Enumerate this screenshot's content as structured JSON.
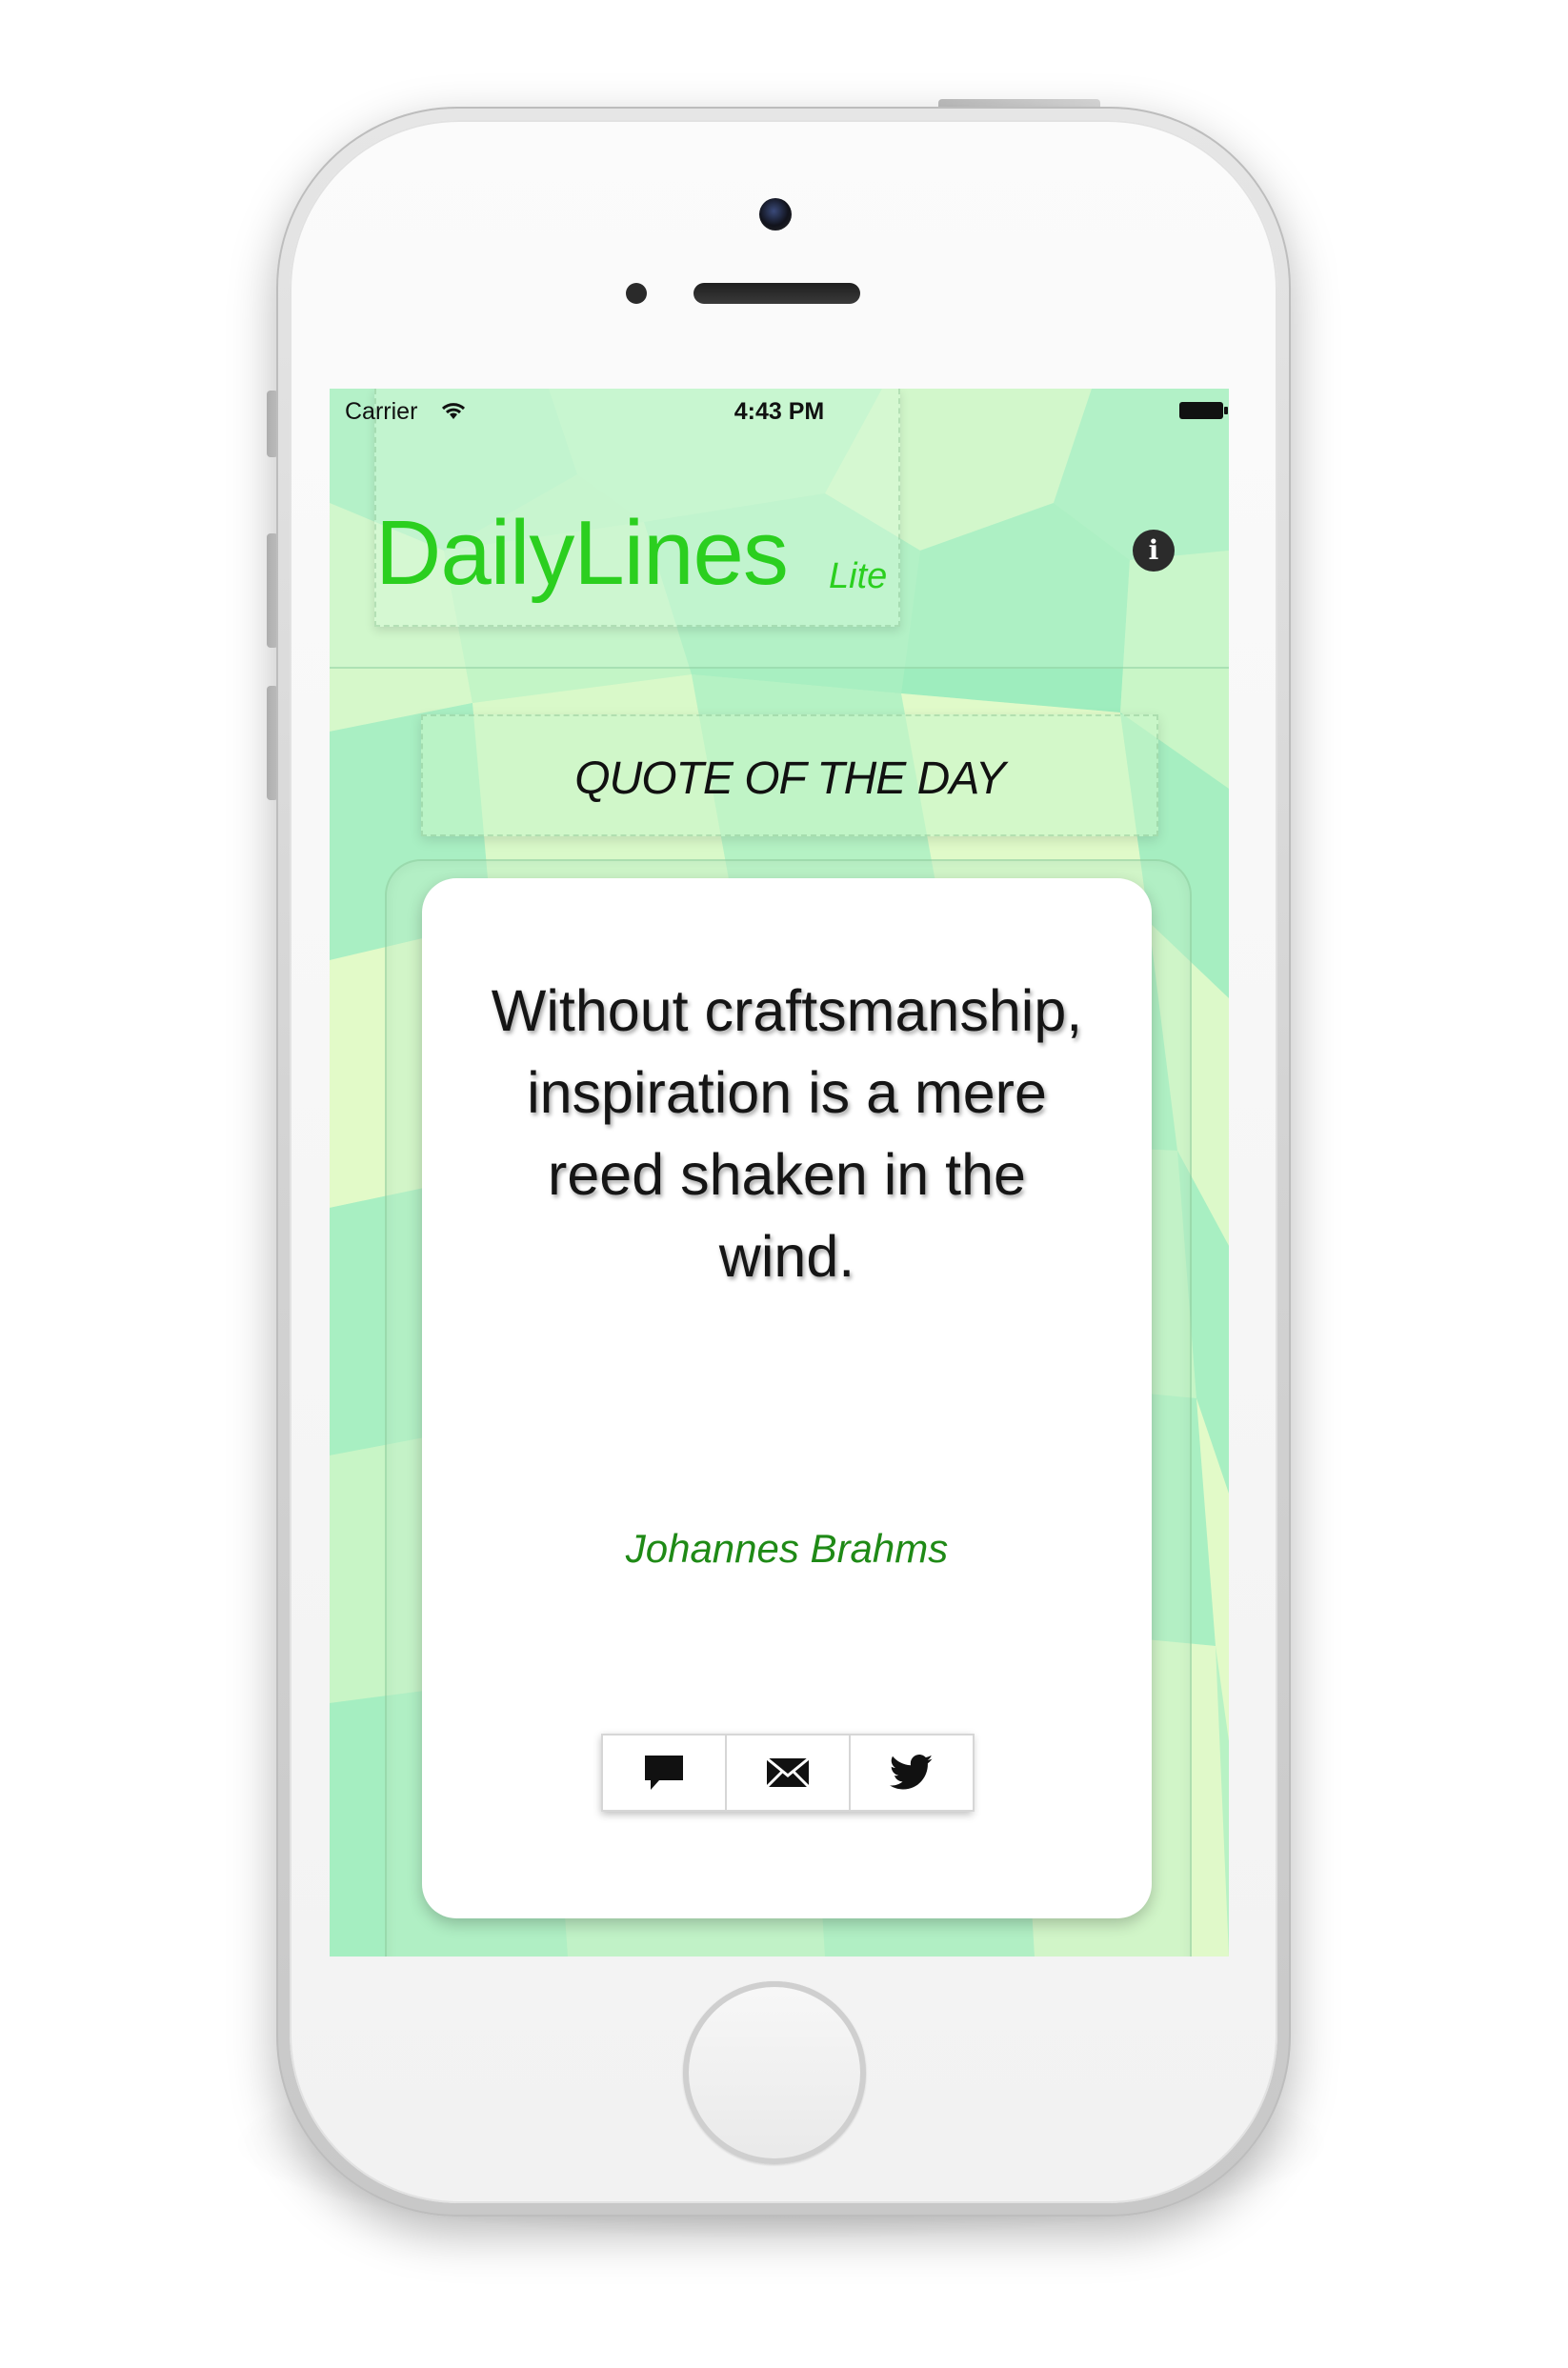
{
  "status_bar": {
    "carrier": "Carrier",
    "time": "4:43 PM"
  },
  "app": {
    "title": "DailyLines",
    "edition": "Lite"
  },
  "section": {
    "heading": "QUOTE OF THE DAY"
  },
  "quote": {
    "text": "Without craftsmanship, inspiration is a mere reed shaken in the wind.",
    "author": "Johannes Brahms"
  },
  "share": {
    "buttons": [
      {
        "icon": "message-icon"
      },
      {
        "icon": "mail-icon"
      },
      {
        "icon": "twitter-icon"
      }
    ]
  },
  "colors": {
    "accent": "#2bcf1f",
    "author": "#1f8a16",
    "background_mint": "#a6f1c1",
    "background_cream": "#e6fac9"
  },
  "icons": {
    "info": "info-icon",
    "wifi": "wifi-icon",
    "battery": "battery-icon"
  }
}
